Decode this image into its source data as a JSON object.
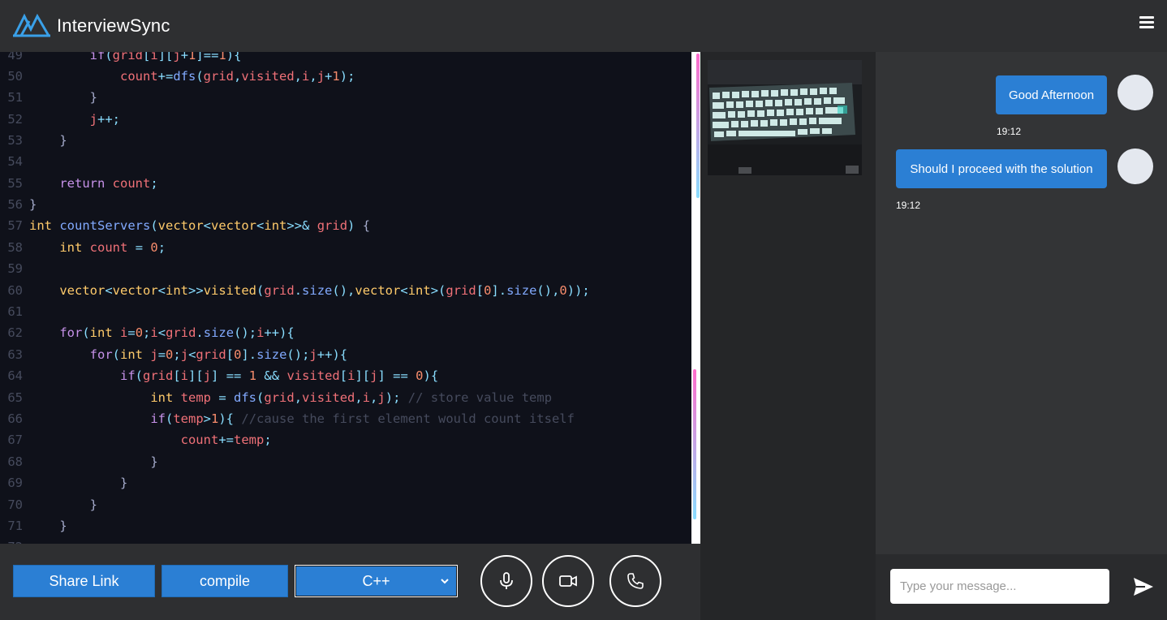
{
  "app": {
    "title": "InterviewSync"
  },
  "header": {
    "menu_icon": "hamburger-menu-icon"
  },
  "editor": {
    "language": "C++"
  },
  "toolbar": {
    "share_label": "Share Link",
    "compile_label": "compile",
    "language_selected": "C++",
    "mic_icon": "microphone-icon",
    "video_icon": "video-camera-icon",
    "call_icon": "phone-icon"
  },
  "chat": {
    "messages": [
      {
        "text": "Good Afternoon",
        "time": "19:12"
      },
      {
        "text": "Should I proceed with the solution",
        "time": "19:12"
      }
    ],
    "input_placeholder": "Type your message...",
    "send_icon": "send-icon"
  },
  "colors": {
    "accent": "#2b7fd4",
    "editor_bg": "#0f111a",
    "header_bg": "#2e2f31",
    "chat_bg": "#333436"
  }
}
